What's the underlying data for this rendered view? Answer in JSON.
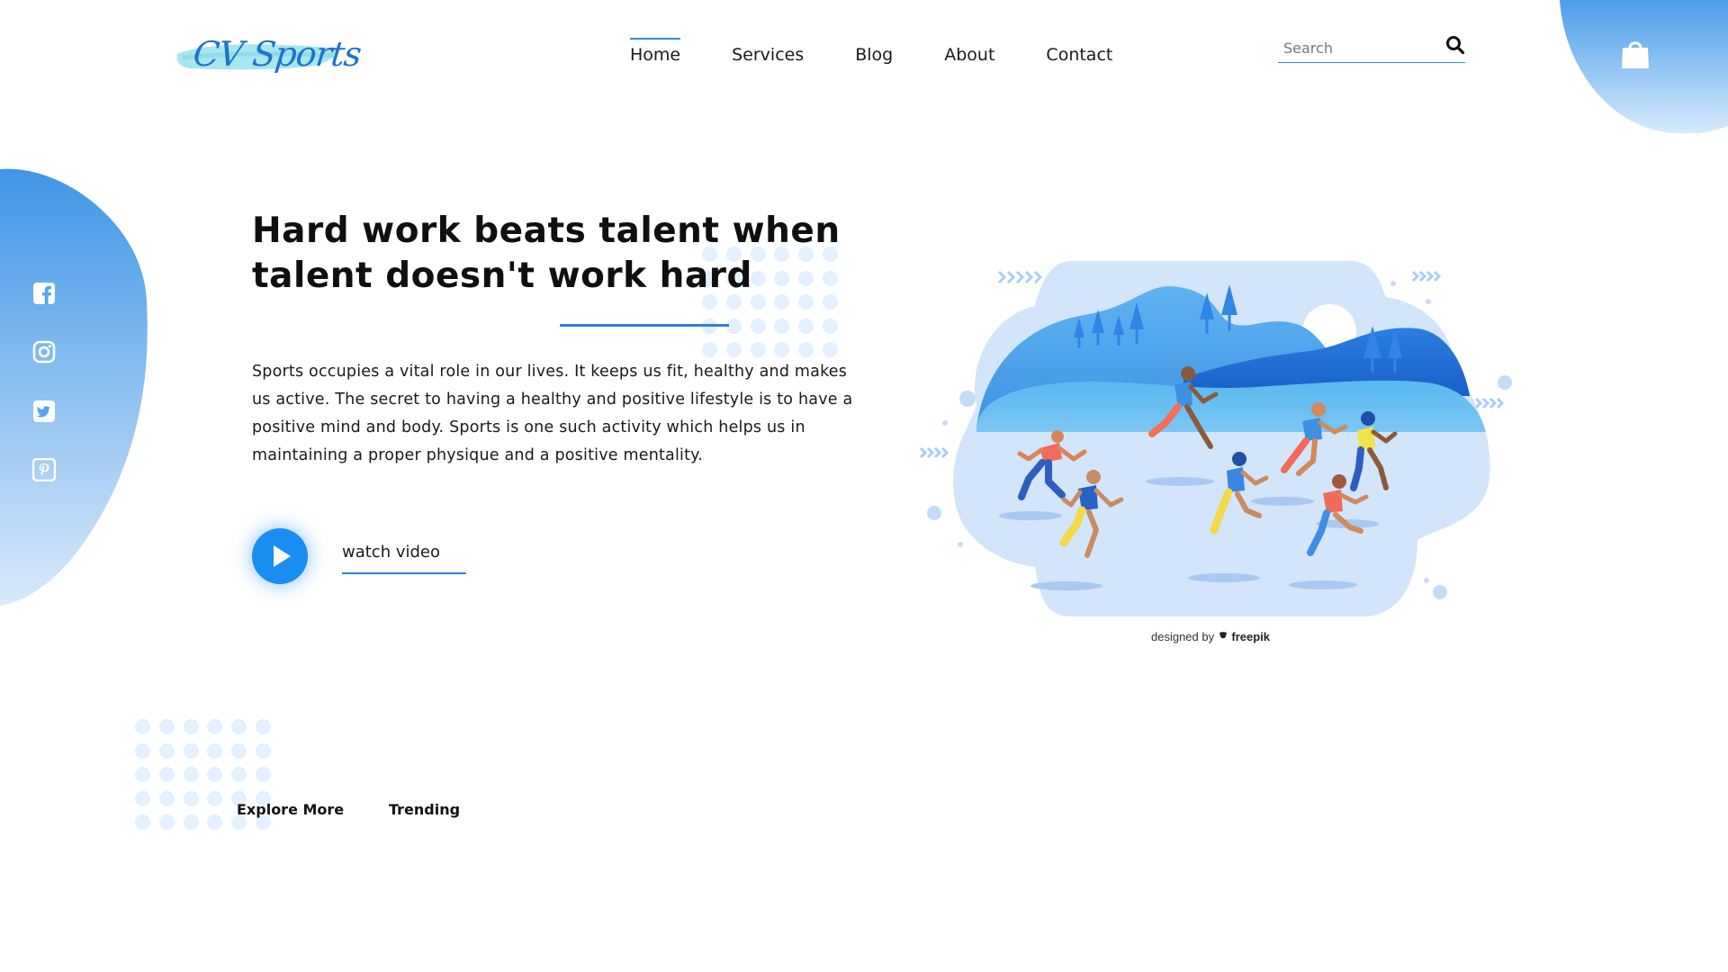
{
  "brand": {
    "logo_text": "CV Sports"
  },
  "nav": {
    "items": [
      {
        "label": "Home",
        "active": true
      },
      {
        "label": "Services",
        "active": false
      },
      {
        "label": "Blog",
        "active": false
      },
      {
        "label": "About",
        "active": false
      },
      {
        "label": "Contact",
        "active": false
      }
    ]
  },
  "search": {
    "placeholder": "Search",
    "value": ""
  },
  "icons": {
    "search": "search-icon",
    "cart": "shopping-bag-icon",
    "social": [
      "facebook-icon",
      "instagram-icon",
      "twitter-icon",
      "pinterest-icon"
    ],
    "play": "play-icon"
  },
  "hero": {
    "title": "Hard work beats talent when talent doesn't work hard",
    "description": "Sports occupies a vital role in our lives. It keeps us fit, healthy and makes us active. The secret to having a healthy and positive lifestyle is to have a positive mind and body. Sports is one such activity which helps us in maintaining a proper physique and a positive mentality.",
    "watch_label": "watch video"
  },
  "illustration": {
    "credit_prefix": "designed by",
    "credit_brand": "freepik"
  },
  "tabs": [
    "Explore More",
    "Trending"
  ],
  "colors": {
    "accent": "#2f8be0",
    "blob_top": "#3d95e8",
    "blob_bottom": "#d6e9fb",
    "dot": "#e3f0fd",
    "play": "#1a8ef0"
  }
}
